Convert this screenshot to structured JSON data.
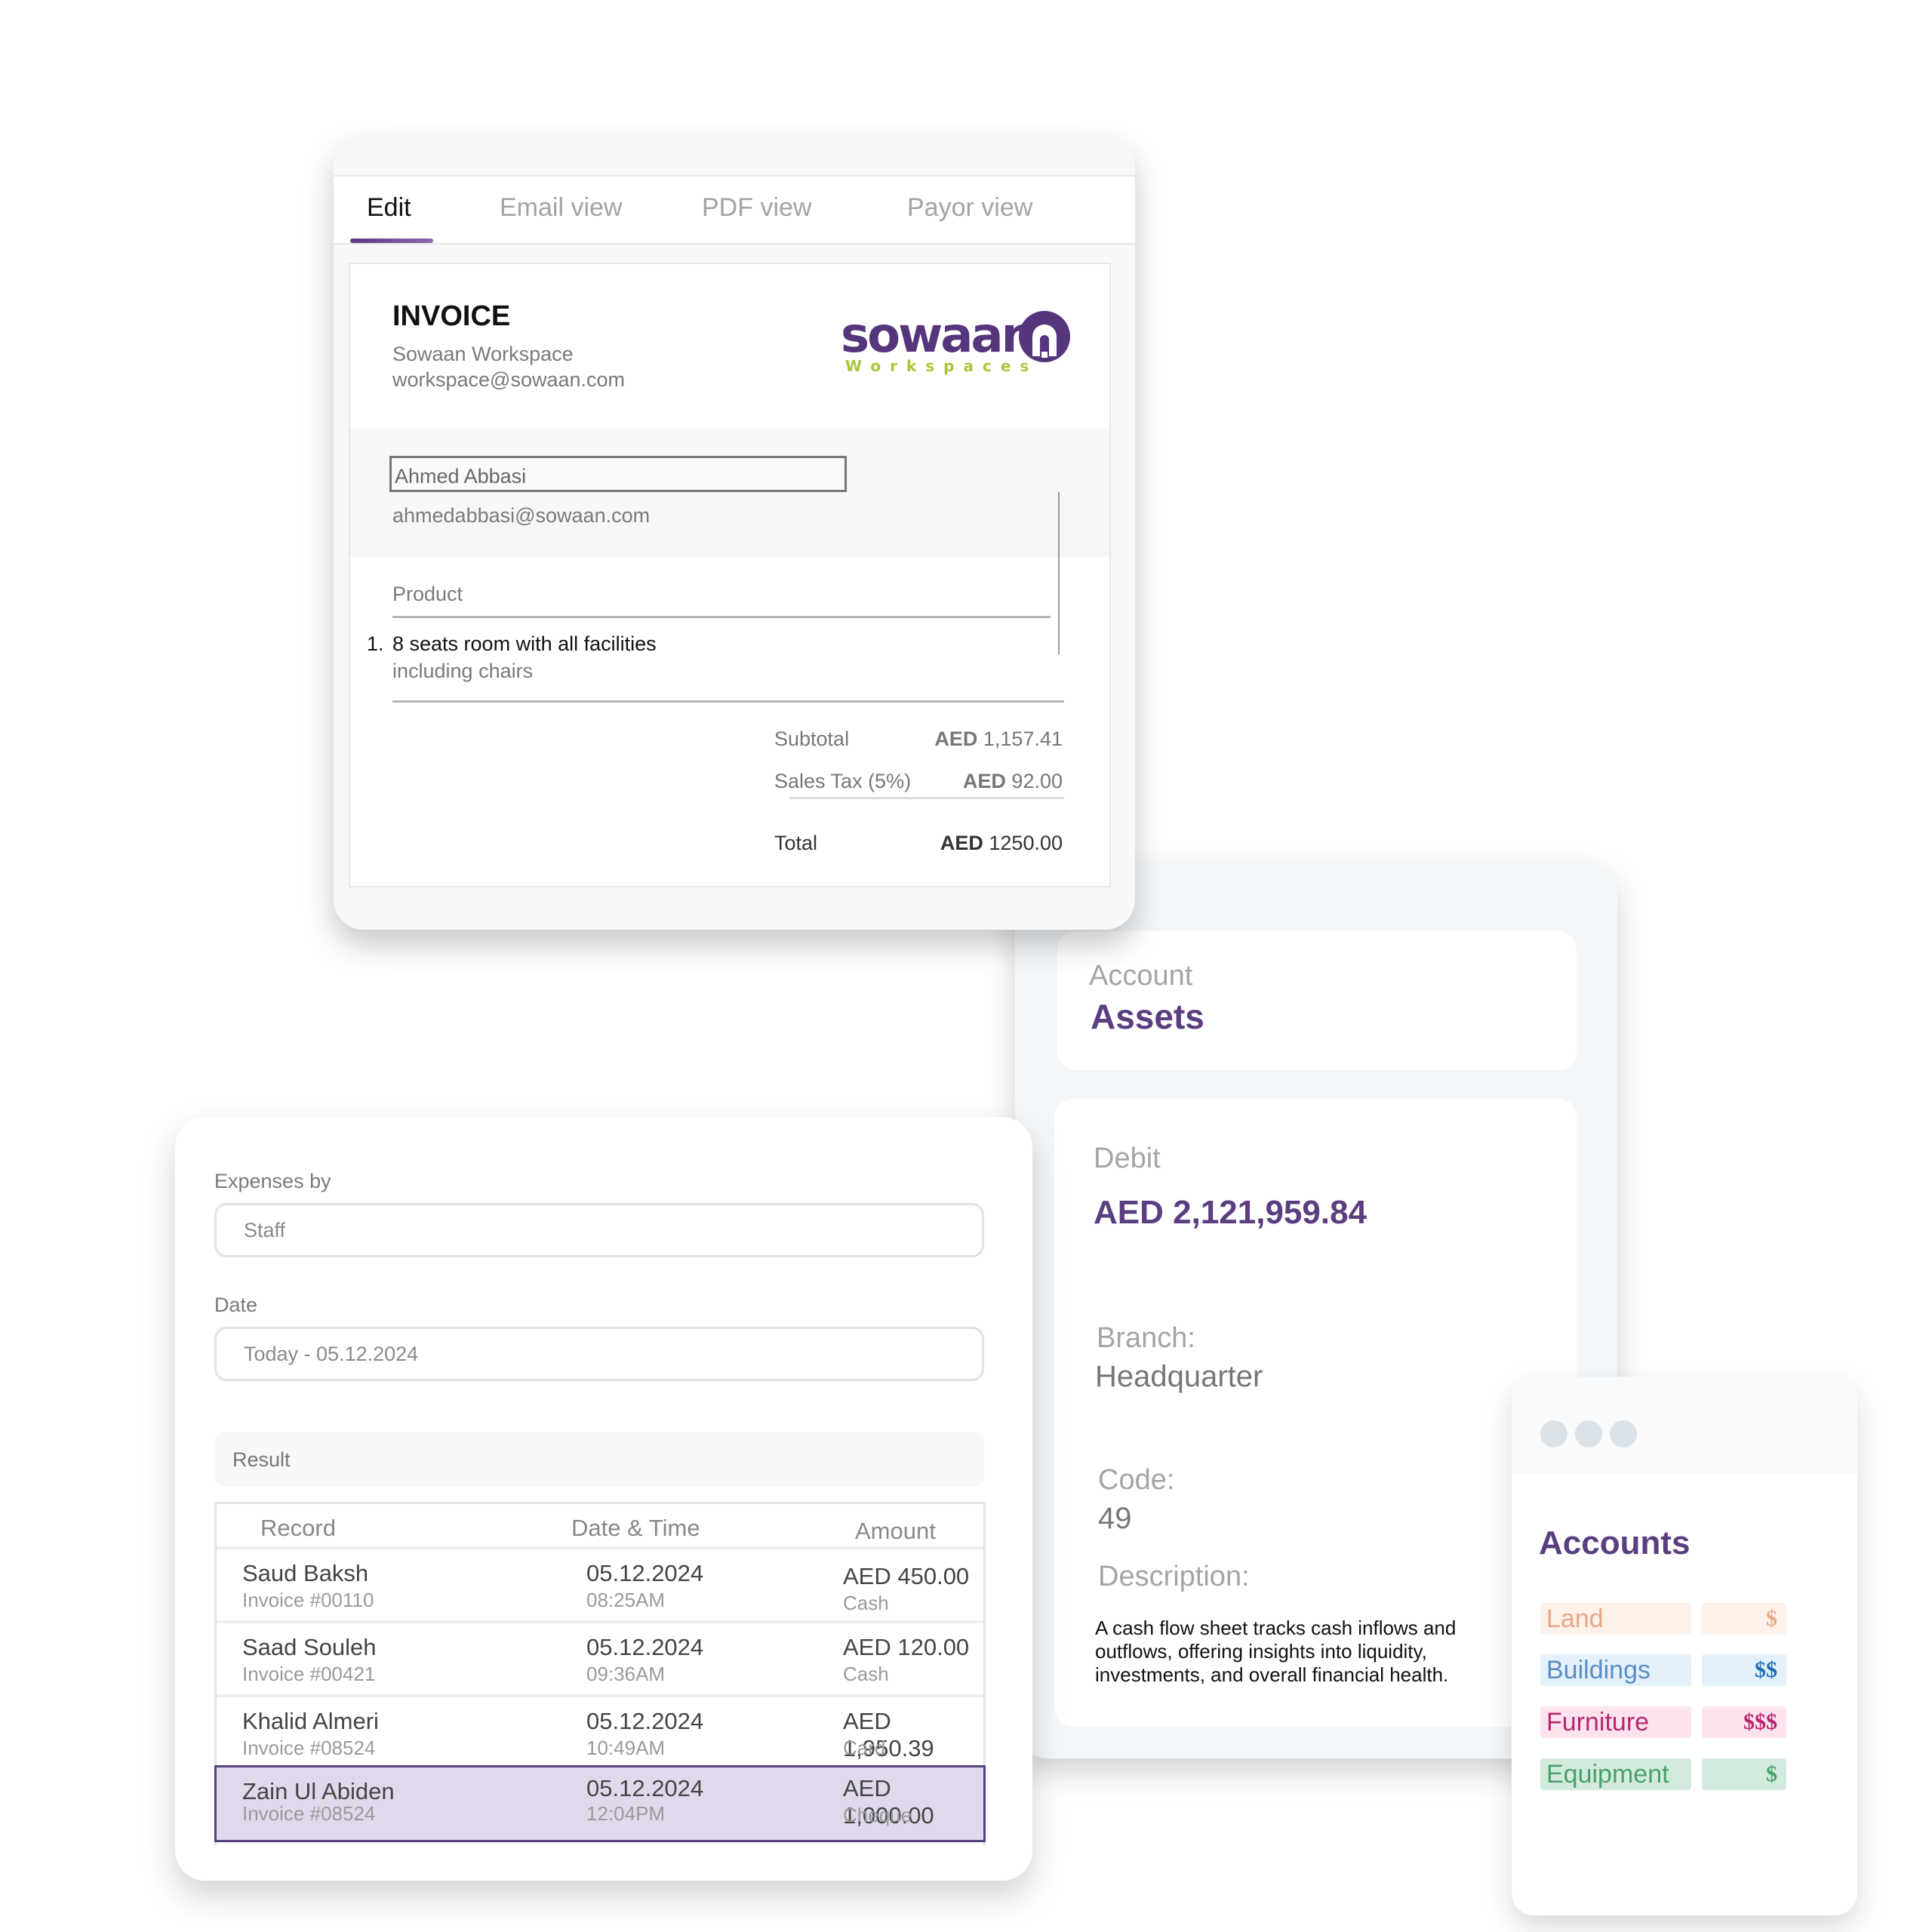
{
  "invoice_editor": {
    "tabs": [
      {
        "label": "Edit",
        "active": true
      },
      {
        "label": "Email view",
        "active": false
      },
      {
        "label": "PDF view",
        "active": false
      },
      {
        "label": "Payor view",
        "active": false
      }
    ],
    "accent_color": "#5b3a84",
    "title": "INVOICE",
    "company_name": "Sowaan Workspace",
    "company_email": "workspace@sowaan.com",
    "logo": {
      "wordmark": "sowaan",
      "tagline": "Workspaces",
      "primary_color": "#55357b",
      "tagline_color": "#a8c63a"
    },
    "payor": {
      "name": "Ahmed Abbasi",
      "email": "ahmedabbasi@sowaan.com"
    },
    "product_header": "Product",
    "items": [
      {
        "number": "1.",
        "name": "8 seats room with all facilities",
        "description": "including chairs"
      }
    ],
    "summary": {
      "subtotal_label": "Subtotal",
      "subtotal_currency": "AED",
      "subtotal_value": "1,157.41",
      "tax_label": "Sales Tax (5%)",
      "tax_currency": "AED",
      "tax_value": "92.00",
      "total_label": "Total",
      "total_currency": "AED",
      "total_value": "1250.00"
    }
  },
  "account_detail": {
    "account_label": "Account",
    "account_value": "Assets",
    "debit_label": "Debit",
    "debit_value": "AED 2,121,959.84",
    "branch_label": "Branch:",
    "branch_value": "Headquarter",
    "code_label": "Code:",
    "code_value": "49",
    "description_label": "Description:",
    "description_value": "A cash flow sheet tracks cash inflows and outflows, offering insights into liquidity, investments, and overall financial health."
  },
  "expenses": {
    "expenses_by_label": "Expenses by",
    "expenses_by_value": "Staff",
    "date_label": "Date",
    "date_value": "Today - 05.12.2024",
    "result_label": "Result",
    "columns": [
      "Record",
      "Date & Time",
      "Amount"
    ],
    "rows": [
      {
        "name": "Saud Baksh",
        "invoice": "Invoice #00110",
        "date": "05.12.2024",
        "time": "08:25AM",
        "amount": "AED 450.00",
        "method": "Cash",
        "selected": false
      },
      {
        "name": "Saad Souleh",
        "invoice": "Invoice #00421",
        "date": "05.12.2024",
        "time": "09:36AM",
        "amount": "AED 120.00",
        "method": "Cash",
        "selected": false
      },
      {
        "name": "Khalid Almeri",
        "invoice": "Invoice #08524",
        "date": "05.12.2024",
        "time": "10:49AM",
        "amount": "AED 1,950.39",
        "method": "Card",
        "selected": false
      },
      {
        "name": "Zain Ul Abiden",
        "invoice": "Invoice #08524",
        "date": "05.12.2024",
        "time": "12:04PM",
        "amount": "AED 1,000.00",
        "method": "Cheque",
        "selected": true
      }
    ]
  },
  "accounts_list": {
    "title": "Accounts",
    "items": [
      {
        "name": "Land",
        "value": "$",
        "text_color": "#e9a987",
        "bg_color": "#fdf1ea",
        "value_color": "#e9a987"
      },
      {
        "name": "Buildings",
        "value": "$$",
        "text_color": "#5b8ec5",
        "bg_color": "#e4f1fa",
        "value_color": "#1f6fb0"
      },
      {
        "name": "Furniture",
        "value": "$$$",
        "text_color": "#b8266e",
        "bg_color": "#fce3ee",
        "value_color": "#b8266e"
      },
      {
        "name": "Equipment",
        "value": "$",
        "text_color": "#4aa06d",
        "bg_color": "#d2ebdc",
        "value_color": "#4aa06d"
      }
    ]
  }
}
